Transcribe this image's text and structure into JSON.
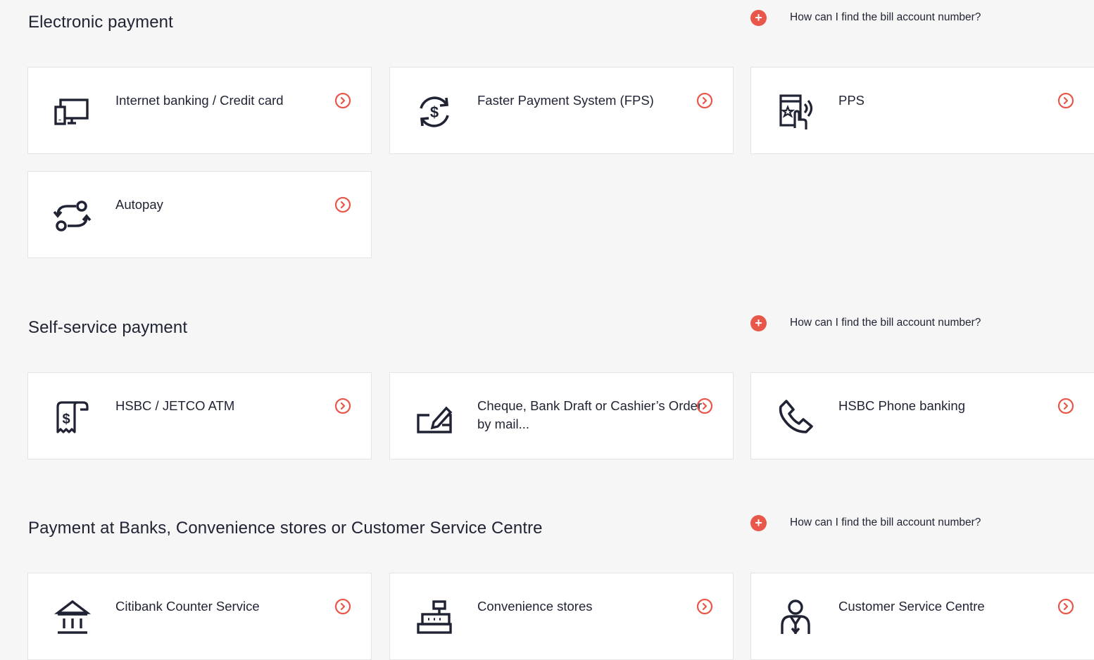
{
  "help_link_text": "How can I find the bill account number?",
  "colors": {
    "accent": "#e8574a",
    "icon": "#1f2333",
    "card_bg": "#ffffff",
    "page_bg": "#f6f6f6"
  },
  "sections": [
    {
      "title": "Electronic payment",
      "help": "How can I find the bill account number?",
      "options": [
        {
          "label": "Internet banking / Credit card",
          "icon": "computer-phone-icon"
        },
        {
          "label": "Faster Payment System (FPS)",
          "icon": "dollar-exchange-icon"
        },
        {
          "label": "PPS",
          "icon": "pps-terminal-icon"
        },
        {
          "label": "Autopay",
          "icon": "autopay-cycle-icon"
        }
      ]
    },
    {
      "title": "Self-service payment",
      "help": "How can I find the bill account number?",
      "options": [
        {
          "label": "HSBC / JETCO ATM",
          "icon": "atm-receipt-icon"
        },
        {
          "label": "Cheque, Bank Draft or Cashier’s Order by mail...",
          "icon": "mail-cheque-icon"
        },
        {
          "label": "HSBC Phone banking",
          "icon": "phone-icon"
        }
      ]
    },
    {
      "title": "Payment at Banks, Convenience stores or Customer Service Centre",
      "help": "How can I find the bill account number?",
      "options": [
        {
          "label": "Citibank Counter Service",
          "icon": "bank-building-icon"
        },
        {
          "label": "Convenience stores",
          "icon": "cash-register-icon"
        },
        {
          "label": "Customer Service Centre",
          "icon": "customer-service-icon"
        }
      ]
    }
  ]
}
